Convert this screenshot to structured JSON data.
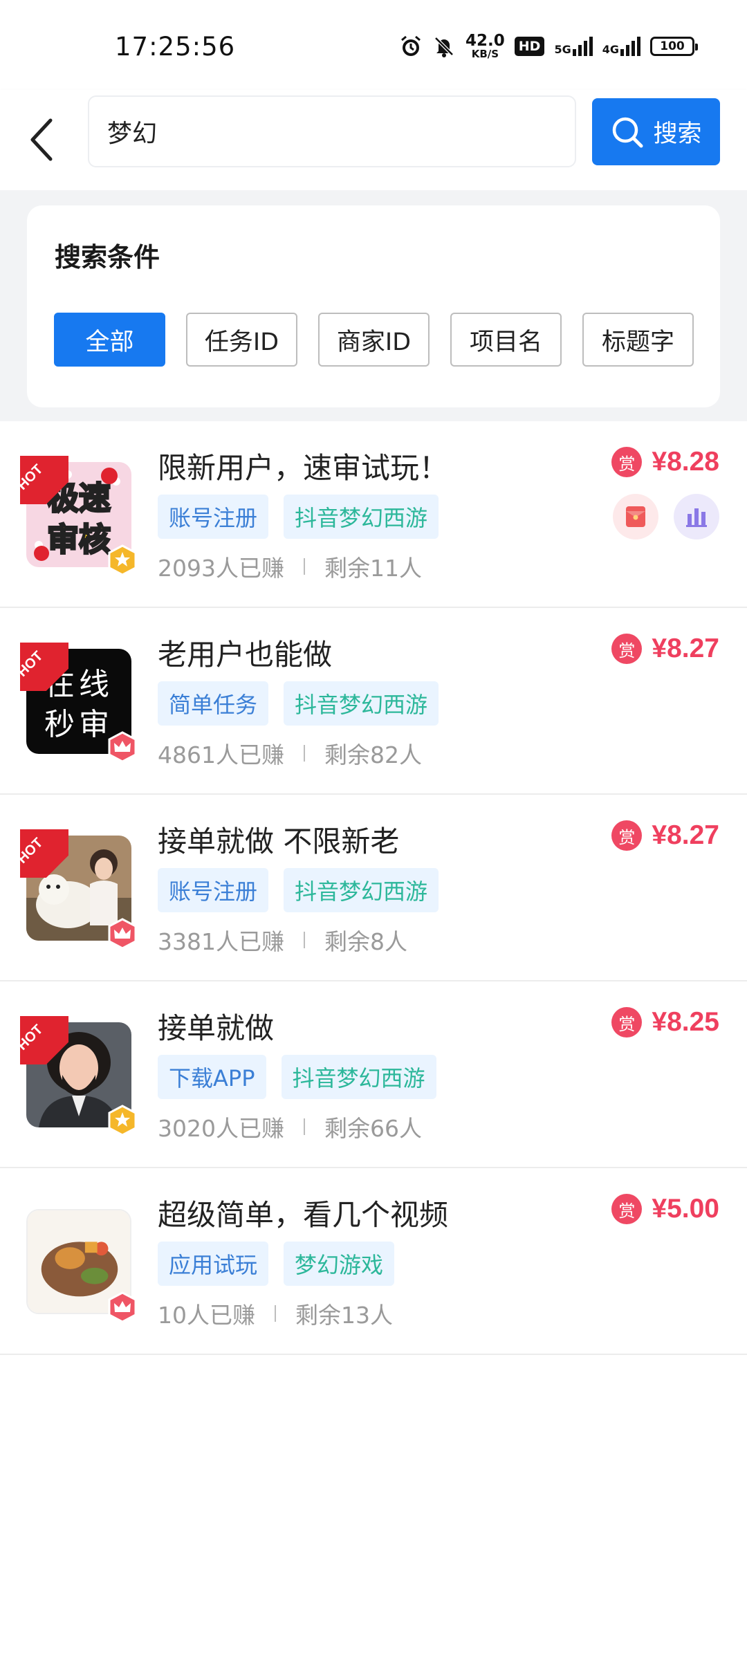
{
  "status_bar": {
    "time": "17:25:56",
    "net_speed": "42.0",
    "net_unit": "KB/S",
    "hd": "HD",
    "net1": "5G",
    "net2": "4G",
    "battery": "100"
  },
  "header": {
    "search_value": "梦幻",
    "search_button": "搜索"
  },
  "filter": {
    "title": "搜索条件",
    "chips": [
      {
        "label": "全部",
        "active": true
      },
      {
        "label": "任务ID",
        "active": false
      },
      {
        "label": "商家ID",
        "active": false
      },
      {
        "label": "项目名",
        "active": false
      },
      {
        "label": "标题字",
        "active": false
      }
    ]
  },
  "tasks": [
    {
      "title": "限新用户，速审试玩！",
      "tags": [
        "账号注册",
        "抖音梦幻西游"
      ],
      "earned": "2093人已赚",
      "remaining": "剩余11人",
      "reward_icon": "赏",
      "price": "¥8.28",
      "hot": "HOT",
      "badge": "star",
      "thumb_text": [
        "极速",
        "审核"
      ]
    },
    {
      "title": "老用户也能做",
      "tags": [
        "简单任务",
        "抖音梦幻西游"
      ],
      "earned": "4861人已赚",
      "remaining": "剩余82人",
      "reward_icon": "赏",
      "price": "¥8.27",
      "hot": "HOT",
      "badge": "crown",
      "thumb_text": [
        "在线",
        "秒审"
      ]
    },
    {
      "title": "接单就做 不限新老",
      "tags": [
        "账号注册",
        "抖音梦幻西游"
      ],
      "earned": "3381人已赚",
      "remaining": "剩余8人",
      "reward_icon": "赏",
      "price": "¥8.27",
      "hot": "HOT",
      "badge": "crown"
    },
    {
      "title": "接单就做",
      "tags": [
        "下载APP",
        "抖音梦幻西游"
      ],
      "earned": "3020人已赚",
      "remaining": "剩余66人",
      "reward_icon": "赏",
      "price": "¥8.25",
      "hot": "HOT",
      "badge": "star"
    },
    {
      "title": "超级简单，看几个视频",
      "tags": [
        "应用试玩",
        "梦幻游戏"
      ],
      "earned": "10人已赚",
      "remaining": "剩余13人",
      "reward_icon": "赏",
      "price": "¥5.00",
      "badge": "crown"
    }
  ],
  "colors": {
    "accent": "#1779f0",
    "price": "#ef3f5e",
    "hot": "#e0232f"
  }
}
